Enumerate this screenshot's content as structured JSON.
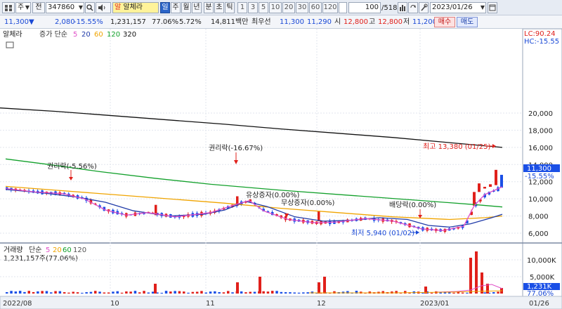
{
  "toolbar": {
    "icon_grid": "grid-icon",
    "market_select": "주",
    "jeon_label": "전",
    "code": "347860",
    "name_prefix": "알",
    "name": "알체라",
    "periods": [
      "일",
      "주",
      "월",
      "년",
      "분",
      "초",
      "틱"
    ],
    "active_period": "일",
    "intervals": [
      "1",
      "3",
      "5",
      "10",
      "20",
      "30",
      "60",
      "120"
    ],
    "view_count": "100",
    "total_count": "/518",
    "date": "2023/01/26"
  },
  "quote": {
    "price": "11,300",
    "arrow": "▼",
    "change": "2,080",
    "change_pct": "-15.55%",
    "volume": "1,231,157",
    "vol_ratio": "77.06%",
    "turnover": "5.72%",
    "amount": "14,811백만",
    "best_ask_label": "최우선",
    "best_ask": "11,300",
    "best_bid": "11,290",
    "open_label": "시",
    "open": "12,800",
    "high_label": "고",
    "high": "12,800",
    "low_label": "저",
    "low": "11,200",
    "buy_btn": "매수",
    "sell_btn": "매도"
  },
  "legend": {
    "stock": "알체라",
    "ma_prefix": "증가 단순",
    "ma_periods": [
      "5",
      "20",
      "60",
      "120",
      "320"
    ]
  },
  "lc_hc": {
    "lc": "LC:90.24",
    "hc": "HC:-15.55"
  },
  "annotations": {
    "right1": "권리락(-5.56%)",
    "right2": "권리락(-16.67%)",
    "free1": "유상증자(0.00%)",
    "free2": "무상증자(0.00%)",
    "dividend": "배당락(0.00%)",
    "high": "최고 13,380 (01/25)",
    "low": "최저 5,940 (01/02)"
  },
  "price_axis": {
    "ticks": [
      "20,000",
      "18,000",
      "16,000",
      "14,000",
      "12,000",
      "10,000",
      "8,000",
      "6,000"
    ],
    "current": "11,300",
    "current_pct": "-15.55%"
  },
  "volume_panel": {
    "legend_label": "거래량",
    "legend_ma": "단순",
    "ma_periods": [
      "5",
      "20",
      "60",
      "120"
    ],
    "info": "1,231,157주(77.06%)",
    "ticks": [
      "10,000K",
      "5,000K"
    ],
    "current": "1,231K",
    "current_pct": "77.06%"
  },
  "x_axis": {
    "labels": [
      "2022/08",
      "10",
      "11",
      "12",
      "2023/01",
      "01/26"
    ]
  },
  "colors": {
    "ma5": "#e04fc8",
    "ma20": "#1f3aa8",
    "ma60": "#f0a400",
    "ma120": "#12a02b",
    "ma320": "#111111",
    "up": "#e0201b",
    "down": "#1a4fe6"
  },
  "chart_data": {
    "type": "candlestick",
    "y_range": [
      5000,
      21500
    ],
    "x_labels": [
      "2022/08",
      "10",
      "11",
      "12",
      "2023/01",
      "01/26"
    ],
    "ma320": [
      [
        0,
        20600
      ],
      [
        80,
        20200
      ],
      [
        160,
        19700
      ],
      [
        240,
        19200
      ],
      [
        320,
        18700
      ],
      [
        400,
        18150
      ],
      [
        480,
        17650
      ],
      [
        560,
        17150
      ],
      [
        640,
        16550
      ],
      [
        715,
        16000
      ]
    ],
    "ma120": [
      [
        8,
        14650
      ],
      [
        70,
        14000
      ],
      [
        140,
        13200
      ],
      [
        220,
        12400
      ],
      [
        300,
        11700
      ],
      [
        400,
        11000
      ],
      [
        500,
        10400
      ],
      [
        600,
        9800
      ],
      [
        680,
        9300
      ],
      [
        715,
        9050
      ]
    ],
    "ma60": [
      [
        8,
        11450
      ],
      [
        80,
        11000
      ],
      [
        160,
        10500
      ],
      [
        240,
        10000
      ],
      [
        320,
        9500
      ],
      [
        400,
        8900
      ],
      [
        480,
        8400
      ],
      [
        560,
        7900
      ],
      [
        640,
        7600
      ],
      [
        690,
        7800
      ],
      [
        715,
        8000
      ]
    ],
    "ma20": [
      [
        8,
        11100
      ],
      [
        60,
        10700
      ],
      [
        110,
        10200
      ],
      [
        150,
        9600
      ],
      [
        190,
        8600
      ],
      [
        240,
        8000
      ],
      [
        290,
        8200
      ],
      [
        320,
        8700
      ],
      [
        350,
        9700
      ],
      [
        380,
        9100
      ],
      [
        420,
        7900
      ],
      [
        460,
        7400
      ],
      [
        500,
        7500
      ],
      [
        540,
        7800
      ],
      [
        580,
        7600
      ],
      [
        610,
        6900
      ],
      [
        640,
        6700
      ],
      [
        670,
        7100
      ],
      [
        700,
        7800
      ],
      [
        715,
        8200
      ]
    ],
    "ma5": [
      [
        8,
        11200
      ],
      [
        50,
        10800
      ],
      [
        90,
        10600
      ],
      [
        120,
        10000
      ],
      [
        150,
        8700
      ],
      [
        180,
        8100
      ],
      [
        210,
        8400
      ],
      [
        250,
        7900
      ],
      [
        300,
        8400
      ],
      [
        330,
        9200
      ],
      [
        355,
        9800
      ],
      [
        375,
        8600
      ],
      [
        410,
        7600
      ],
      [
        450,
        7200
      ],
      [
        480,
        7300
      ],
      [
        520,
        7700
      ],
      [
        560,
        7400
      ],
      [
        600,
        6500
      ],
      [
        630,
        6300
      ],
      [
        660,
        6800
      ],
      [
        675,
        9200
      ],
      [
        690,
        10500
      ],
      [
        715,
        11400
      ]
    ]
  }
}
